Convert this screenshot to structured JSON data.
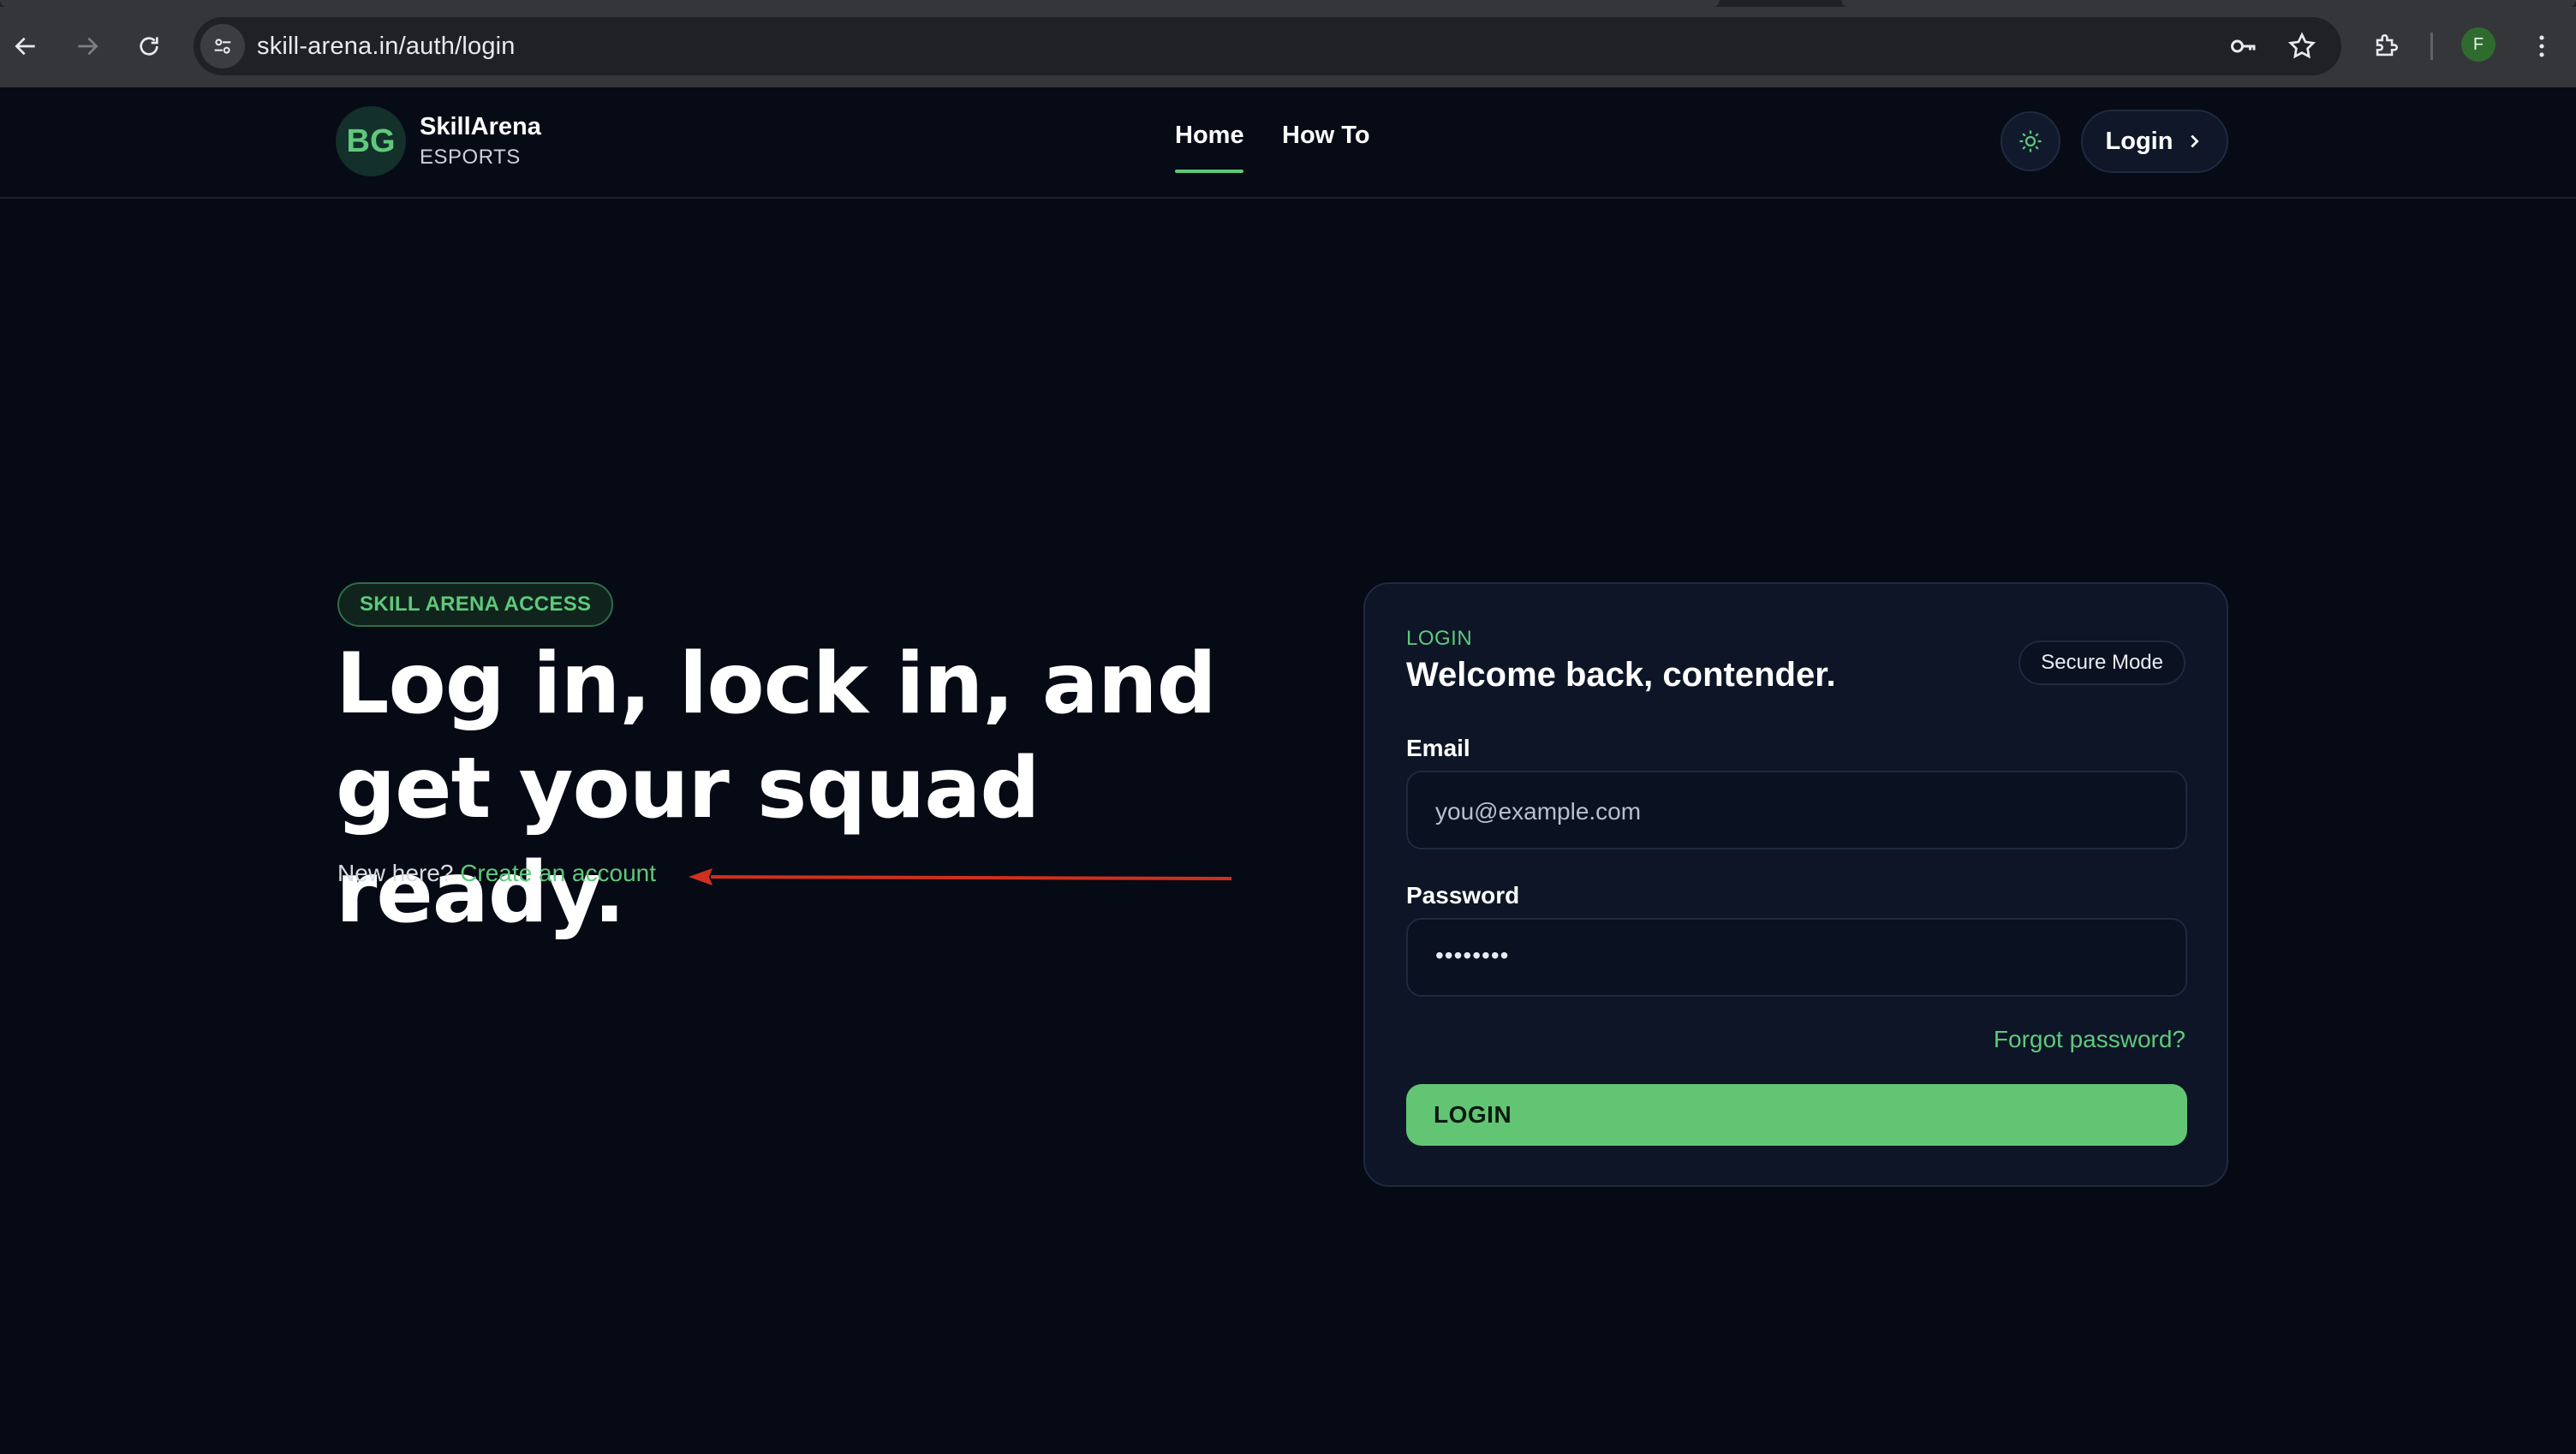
{
  "browser": {
    "url": "skill-arena.in/auth/login",
    "profile_initial": "F",
    "icons": [
      "back-arrow-icon",
      "forward-arrow-icon",
      "reload-icon",
      "site-info-icon",
      "password-key-icon",
      "bookmark-star-icon",
      "extensions-puzzle-icon",
      "kebab-menu-icon"
    ]
  },
  "header": {
    "logo_text": "BG",
    "brand_name": "SkillArena",
    "brand_sub": "ESPORTS",
    "nav": [
      {
        "label": "Home",
        "active": true
      },
      {
        "label": "How To",
        "active": false
      }
    ],
    "theme_icon": "sun-icon",
    "login_label": "Login",
    "login_icon": "chevron-right-icon"
  },
  "hero": {
    "badge": "SKILL ARENA ACCESS",
    "title": "Log in, lock in, and get your squad ready.",
    "new_here": "New here?",
    "create_link": "Create an account"
  },
  "card": {
    "eyebrow": "LOGIN",
    "title": "Welcome back, contender.",
    "secure_badge": "Secure Mode",
    "email_label": "Email",
    "email_placeholder": "you@example.com",
    "password_label": "Password",
    "password_value": "••••••••",
    "forgot": "Forgot password?",
    "submit": "LOGIN"
  },
  "colors": {
    "background": "#060a14",
    "accent": "#5ec97c",
    "card": "#0d1526",
    "annotation_arrow": "#d0301f"
  }
}
